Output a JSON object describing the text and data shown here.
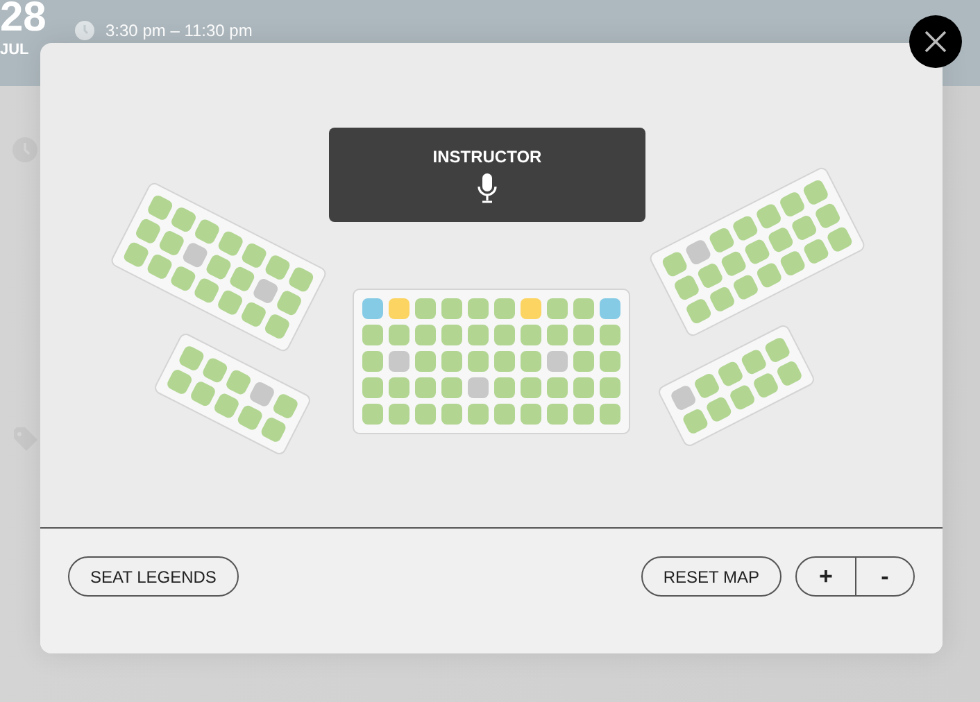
{
  "background": {
    "day": "28",
    "month": "JUL",
    "time": "3:30 pm – 11:30 pm"
  },
  "instructor": {
    "label": "INSTRUCTOR"
  },
  "blocks": [
    {
      "rows": [
        {
          "seats": [
            {
              "color": "#b2d692"
            },
            {
              "color": "#b2d692"
            },
            {
              "color": "#b2d692"
            },
            {
              "color": "#b2d692"
            },
            {
              "color": "#b2d692"
            },
            {
              "color": "#b2d692"
            },
            {
              "color": "#b2d692"
            }
          ]
        },
        {
          "seats": [
            {
              "color": "#b2d692"
            },
            {
              "color": "#b2d692"
            },
            {
              "color": "#c8c8c8"
            },
            {
              "color": "#b2d692"
            },
            {
              "color": "#b2d692"
            },
            {
              "color": "#c8c8c8"
            },
            {
              "color": "#b2d692"
            }
          ]
        },
        {
          "seats": [
            {
              "color": "#b2d692"
            },
            {
              "color": "#b2d692"
            },
            {
              "color": "#b2d692"
            },
            {
              "color": "#b2d692"
            },
            {
              "color": "#b2d692"
            },
            {
              "color": "#b2d692"
            },
            {
              "color": "#b2d692"
            }
          ]
        }
      ]
    },
    {
      "rows": [
        {
          "seats": [
            {
              "color": "#b2d692"
            },
            {
              "color": "#b2d692"
            },
            {
              "color": "#b2d692"
            },
            {
              "color": "#c8c8c8"
            },
            {
              "color": "#b2d692"
            }
          ]
        },
        {
          "seats": [
            {
              "color": "#b2d692"
            },
            {
              "color": "#b2d692"
            },
            {
              "color": "#b2d692"
            },
            {
              "color": "#b2d692"
            },
            {
              "color": "#b2d692"
            }
          ]
        }
      ]
    },
    {
      "rows": [
        {
          "seats": [
            {
              "color": "#86cbe6"
            },
            {
              "color": "#fcd462"
            },
            {
              "color": "#b2d692"
            },
            {
              "color": "#b2d692"
            },
            {
              "color": "#b2d692"
            },
            {
              "color": "#b2d692"
            },
            {
              "color": "#fcd462"
            },
            {
              "color": "#b2d692"
            },
            {
              "color": "#b2d692"
            },
            {
              "color": "#86cbe6"
            }
          ]
        },
        {
          "seats": [
            {
              "color": "#b2d692"
            },
            {
              "color": "#b2d692"
            },
            {
              "color": "#b2d692"
            },
            {
              "color": "#b2d692"
            },
            {
              "color": "#b2d692"
            },
            {
              "color": "#b2d692"
            },
            {
              "color": "#b2d692"
            },
            {
              "color": "#b2d692"
            },
            {
              "color": "#b2d692"
            },
            {
              "color": "#b2d692"
            }
          ]
        },
        {
          "seats": [
            {
              "color": "#b2d692"
            },
            {
              "color": "#c8c8c8"
            },
            {
              "color": "#b2d692"
            },
            {
              "color": "#b2d692"
            },
            {
              "color": "#b2d692"
            },
            {
              "color": "#b2d692"
            },
            {
              "color": "#b2d692"
            },
            {
              "color": "#c8c8c8"
            },
            {
              "color": "#b2d692"
            },
            {
              "color": "#b2d692"
            }
          ]
        },
        {
          "seats": [
            {
              "color": "#b2d692"
            },
            {
              "color": "#b2d692"
            },
            {
              "color": "#b2d692"
            },
            {
              "color": "#b2d692"
            },
            {
              "color": "#c8c8c8"
            },
            {
              "color": "#b2d692"
            },
            {
              "color": "#b2d692"
            },
            {
              "color": "#b2d692"
            },
            {
              "color": "#b2d692"
            },
            {
              "color": "#b2d692"
            }
          ]
        },
        {
          "seats": [
            {
              "color": "#b2d692"
            },
            {
              "color": "#b2d692"
            },
            {
              "color": "#b2d692"
            },
            {
              "color": "#b2d692"
            },
            {
              "color": "#b2d692"
            },
            {
              "color": "#b2d692"
            },
            {
              "color": "#b2d692"
            },
            {
              "color": "#b2d692"
            },
            {
              "color": "#b2d692"
            },
            {
              "color": "#b2d692"
            }
          ]
        }
      ]
    },
    {
      "rows": [
        {
          "seats": [
            {
              "color": "#b2d692"
            },
            {
              "color": "#c8c8c8"
            },
            {
              "color": "#b2d692"
            },
            {
              "color": "#b2d692"
            },
            {
              "color": "#b2d692"
            },
            {
              "color": "#b2d692"
            },
            {
              "color": "#b2d692"
            }
          ]
        },
        {
          "seats": [
            {
              "color": "#b2d692"
            },
            {
              "color": "#b2d692"
            },
            {
              "color": "#b2d692"
            },
            {
              "color": "#b2d692"
            },
            {
              "color": "#b2d692"
            },
            {
              "color": "#b2d692"
            },
            {
              "color": "#b2d692"
            }
          ]
        },
        {
          "seats": [
            {
              "color": "#b2d692"
            },
            {
              "color": "#b2d692"
            },
            {
              "color": "#b2d692"
            },
            {
              "color": "#b2d692"
            },
            {
              "color": "#b2d692"
            },
            {
              "color": "#b2d692"
            },
            {
              "color": "#b2d692"
            }
          ]
        }
      ]
    },
    {
      "rows": [
        {
          "seats": [
            {
              "color": "#c8c8c8"
            },
            {
              "color": "#b2d692"
            },
            {
              "color": "#b2d692"
            },
            {
              "color": "#b2d692"
            },
            {
              "color": "#b2d692"
            }
          ]
        },
        {
          "seats": [
            {
              "color": "#b2d692"
            },
            {
              "color": "#b2d692"
            },
            {
              "color": "#b2d692"
            },
            {
              "color": "#b2d692"
            },
            {
              "color": "#b2d692"
            }
          ]
        }
      ]
    }
  ],
  "footer": {
    "legend_button": "SEAT LEGENDS",
    "reset_button": "RESET MAP",
    "zoom_in": "+",
    "zoom_out": "-"
  }
}
